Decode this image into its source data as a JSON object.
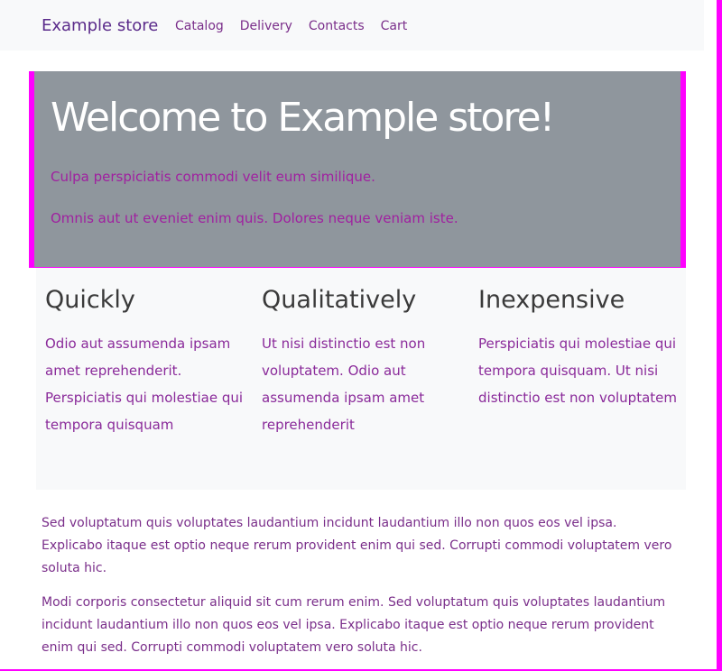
{
  "header": {
    "brand": "Example store",
    "nav": [
      "Catalog",
      "Delivery",
      "Contacts",
      "Cart"
    ]
  },
  "hero": {
    "title": "Welcome to Example store!",
    "p1": "Culpa perspiciatis commodi velit eum similique.",
    "p2": "Omnis aut ut eveniet enim quis. Dolores neque veniam iste."
  },
  "features": [
    {
      "title": "Quickly",
      "text": "Odio aut assumenda ipsam amet reprehenderit. Perspiciatis qui molestiae qui tempora quisquam"
    },
    {
      "title": "Qualitatively",
      "text": "Ut nisi distinctio est non voluptatem. Odio aut assumenda ipsam amet reprehenderit"
    },
    {
      "title": "Inexpensive",
      "text": "Perspiciatis qui molestiae qui tempora quisquam. Ut nisi distinctio est non voluptatem"
    }
  ],
  "footer": {
    "p1": "Sed voluptatum quis voluptates laudantium incidunt laudantium illo non quos eos vel ipsa. Explicabo itaque est optio neque rerum provident enim qui sed. Corrupti commodi voluptatem vero soluta hic.",
    "p2": "Modi corporis consectetur aliquid sit cum rerum enim. Sed voluptatum quis voluptates laudantium incidunt laudantium illo non quos eos vel ipsa. Explicabo itaque est optio neque rerum provident enim qui sed. Corrupti commodi voluptatem vero soluta hic."
  },
  "colors": {
    "accent": "#ff00ff",
    "hero_bg": "#8f969d",
    "panel_bg": "#f8f9fa"
  }
}
